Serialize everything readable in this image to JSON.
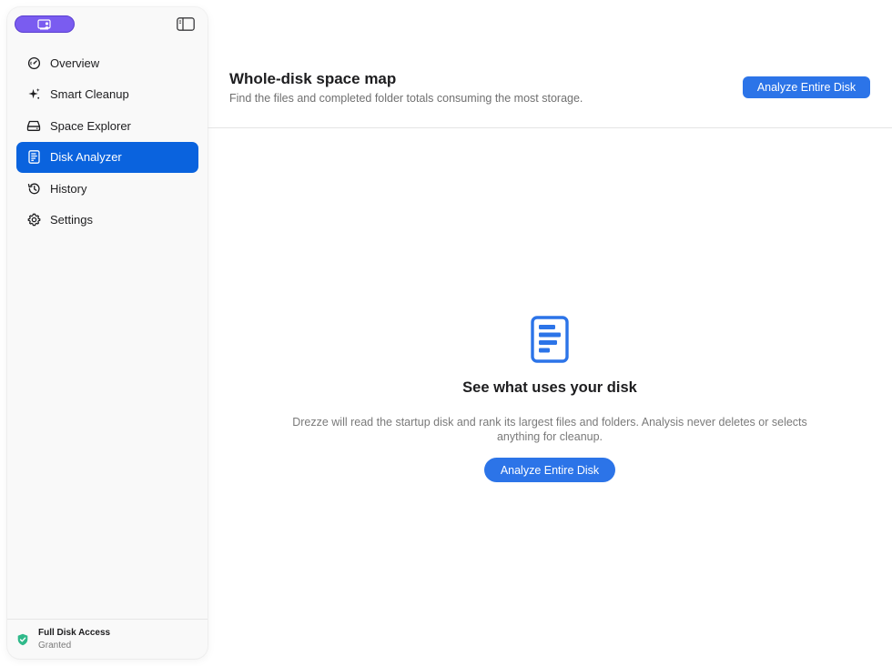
{
  "sidebar": {
    "logo_icon": "app-logo-icon",
    "toggle_icon": "sidebar-toggle-icon",
    "items": [
      {
        "label": "Overview",
        "icon": "gauge-icon",
        "active": false
      },
      {
        "label": "Smart Cleanup",
        "icon": "sparkles-icon",
        "active": false
      },
      {
        "label": "Space Explorer",
        "icon": "drive-icon",
        "active": false
      },
      {
        "label": "Disk Analyzer",
        "icon": "document-chart-icon",
        "active": true
      },
      {
        "label": "History",
        "icon": "history-icon",
        "active": false
      },
      {
        "label": "Settings",
        "icon": "gear-icon",
        "active": false
      }
    ],
    "footer": {
      "title": "Full Disk Access",
      "status": "Granted",
      "icon": "shield-check-icon"
    }
  },
  "header": {
    "title": "Whole-disk space map",
    "subtitle": "Find the files and completed folder totals consuming the most storage.",
    "button_label": "Analyze Entire Disk"
  },
  "empty_state": {
    "icon": "document-chart-icon",
    "heading": "See what uses your disk",
    "description": "Drezze will read the startup disk and rank its largest files and folders. Analysis never deletes or selects anything for cleanup.",
    "button_label": "Analyze Entire Disk"
  },
  "colors": {
    "accent": "#2c74e8",
    "active_nav": "#0a63de",
    "logo": "#7a5cf0",
    "granted": "#2fb98a"
  }
}
